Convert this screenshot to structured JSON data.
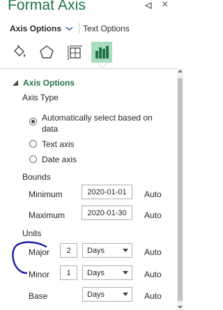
{
  "header": {
    "title": "Format Axis",
    "pin_icon": "pin-down-icon",
    "close_icon": "close-icon",
    "close_glyph": "×"
  },
  "tabs": {
    "axis_options": "Axis Options",
    "text_options": "Text Options"
  },
  "icon_tabs": [
    {
      "name": "fill-line-icon",
      "active": false
    },
    {
      "name": "effects-pentagon-icon",
      "active": false
    },
    {
      "name": "size-properties-icon",
      "active": false
    },
    {
      "name": "axis-options-bar-chart-icon",
      "active": true
    }
  ],
  "section": {
    "title": "Axis Options",
    "axis_type_label": "Axis Type",
    "radio_auto_line1": "Automatically select based on",
    "radio_auto_line2": "data",
    "radio_text": "Text axis",
    "radio_date": "Date axis",
    "selected_axis_type": "auto",
    "bounds_label": "Bounds",
    "minimum_label": "Minimum",
    "minimum_value": "2020-01-01",
    "minimum_auto": "Auto",
    "maximum_label": "Maximum",
    "maximum_value": "2020-01-30",
    "maximum_auto": "Auto",
    "units_label": "Units",
    "major_label": "Major",
    "major_value": "2",
    "major_unit": "Days",
    "major_auto": "Auto",
    "minor_label": "Minor",
    "minor_value": "1",
    "minor_unit": "Days",
    "minor_auto": "Auto",
    "base_label": "Base",
    "base_unit": "Days",
    "base_auto": "Auto"
  },
  "colors": {
    "accent_green": "#217346",
    "active_tab_bg": "#a8dcc0",
    "annotation_ink": "#1a1aa6"
  }
}
